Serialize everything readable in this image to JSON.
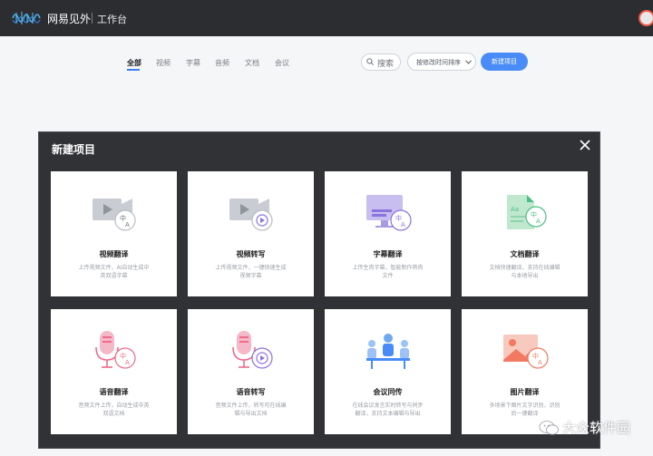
{
  "header": {
    "brand": "网易见外",
    "workspace": "工作台"
  },
  "toolbar": {
    "tabs": [
      {
        "label": "全部",
        "active": true
      },
      {
        "label": "视频",
        "active": false
      },
      {
        "label": "字幕",
        "active": false
      },
      {
        "label": "音频",
        "active": false
      },
      {
        "label": "文档",
        "active": false
      },
      {
        "label": "会议",
        "active": false
      }
    ],
    "search_label": "搜索",
    "sort_label": "按修改时间排序",
    "new_project_label": "新建项目"
  },
  "modal": {
    "title": "新建项目",
    "cards": [
      {
        "title": "视频翻译",
        "desc": "上传视频文件，AI自动生成中英双语字幕",
        "icon": "video-translate-icon"
      },
      {
        "title": "视频转写",
        "desc": "上传视频文件，一键快速生成视频字幕",
        "icon": "video-transcribe-icon"
      },
      {
        "title": "字幕翻译",
        "desc": "上传生肉字幕，智能制作熟肉文件",
        "icon": "subtitle-translate-icon"
      },
      {
        "title": "文档翻译",
        "desc": "文档快速翻译，支持在线编辑与本地导出",
        "icon": "document-translate-icon"
      },
      {
        "title": "语音翻译",
        "desc": "音频文件上传，自动生成中英双语文档",
        "icon": "audio-translate-icon"
      },
      {
        "title": "语音转写",
        "desc": "音频文件上传，转写可在线编辑与导出文档",
        "icon": "audio-transcribe-icon"
      },
      {
        "title": "会议同传",
        "desc": "在线会议发言实时转写与同步翻译，支持文本编辑与导出",
        "icon": "meeting-interpret-icon"
      },
      {
        "title": "图片翻译",
        "desc": "多场景下图片文字识别，识别后一键翻译",
        "icon": "image-translate-icon"
      }
    ]
  },
  "watermark": {
    "text": "大众软件园"
  },
  "colors": {
    "accent": "#4a8cf7",
    "topbar": "#2b2d31",
    "modal_bg": "#303236",
    "icon_pink": "#f06a8a",
    "icon_purple": "#8b73e0",
    "icon_green": "#4cbf84"
  }
}
